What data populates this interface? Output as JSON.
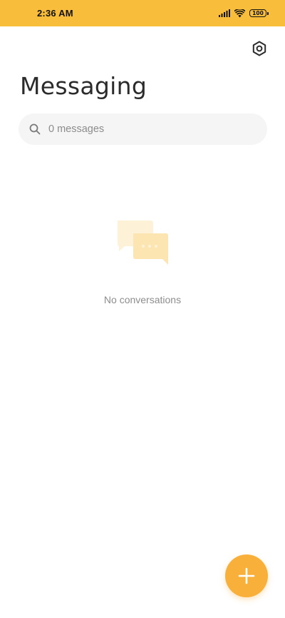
{
  "status_bar": {
    "time": "2:36 AM",
    "battery_level": "100",
    "icons": [
      "signal-icon",
      "wifi-icon",
      "battery-icon"
    ]
  },
  "header": {
    "title": "Messaging",
    "settings_icon": "settings-icon"
  },
  "search": {
    "placeholder": "0 messages",
    "icon": "search-icon"
  },
  "empty_state": {
    "icon": "chat-bubbles-icon",
    "message": "No conversations"
  },
  "fab": {
    "icon": "plus-icon"
  },
  "colors": {
    "status_bar": "#f9bd3c",
    "accent": "#f9b03b",
    "illustration_light": "#fdf1d8",
    "illustration_dark": "#fde5b2"
  }
}
